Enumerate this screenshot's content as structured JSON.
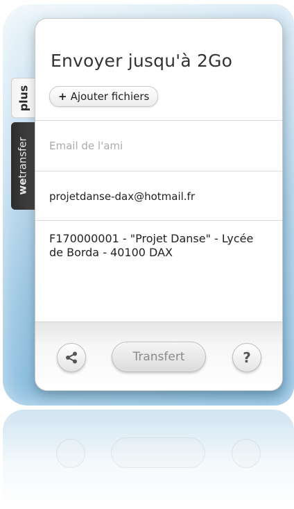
{
  "panel": {
    "title": "Envoyer jusqu'à 2Go",
    "add_files_label": "Ajouter fichiers"
  },
  "side_tabs": {
    "plus_label": "plus",
    "wetransfer_prefix": "we",
    "wetransfer_suffix": "transfer"
  },
  "form": {
    "friend_email_placeholder": "Email de l'ami",
    "friend_email_value": "",
    "sender_email_value": "projetdanse-dax@hotmail.fr",
    "message_value": "F170000001 - \"Projet Danse\" - Lycée de Borda - 40100 DAX"
  },
  "footer": {
    "transfer_label": "Transfert",
    "help_label": "?"
  },
  "icons": {
    "share": "share-icon",
    "help": "question-mark-icon",
    "plus": "plus-icon"
  },
  "colors": {
    "backdrop_accent": "#7db6db",
    "tab_dark": "#2c2c2c",
    "text_primary": "#333333",
    "placeholder": "#aaaaaa",
    "transfer_disabled_text": "#8a8a8a"
  }
}
